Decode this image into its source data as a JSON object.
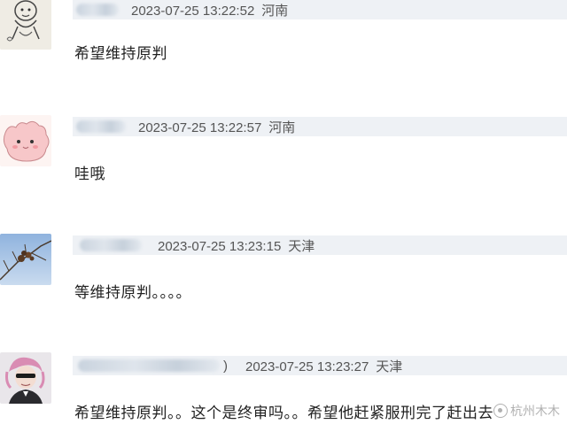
{
  "comments": [
    {
      "timestamp": "2023-07-25 13:22:52",
      "location": "河南",
      "text": "希望维持原判",
      "avatar": "cartoon-gesture-avatar"
    },
    {
      "timestamp": "2023-07-25 13:22:57",
      "location": "河南",
      "text": "哇哦",
      "avatar": "pink-creature-avatar"
    },
    {
      "timestamp": "2023-07-25 13:23:15",
      "location": "天津",
      "text": "等维持原判。。。。",
      "avatar": "tree-branch-avatar"
    },
    {
      "timestamp": "2023-07-25 13:23:27",
      "location": "天津",
      "name_suffix": ")",
      "text": "希望维持原判。。这个是终审吗。。希望他赶紧服刑完了赶出去",
      "avatar": "anime-character-avatar"
    }
  ],
  "watermark": {
    "text": "杭州木木",
    "icon": "watermark-logo-icon"
  },
  "colors": {
    "meta_bar_bg": "#eef1f5",
    "meta_text": "#555555",
    "comment_text": "#222222"
  }
}
